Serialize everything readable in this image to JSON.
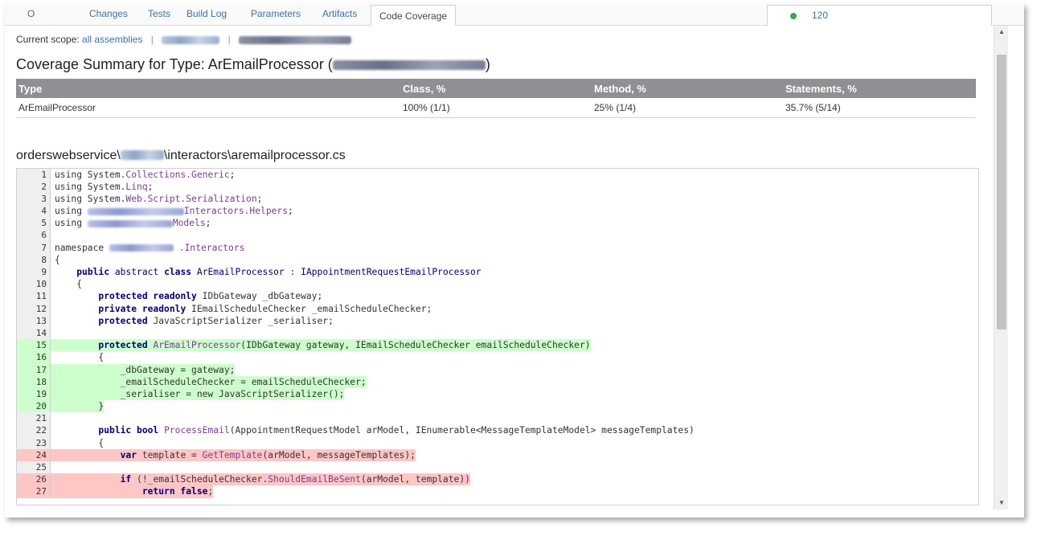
{
  "tabs": [
    {
      "label": "O"
    },
    {
      "label": "Changes"
    },
    {
      "label": "Tests"
    },
    {
      "label": "Build Log"
    },
    {
      "label": "Parameters"
    },
    {
      "label": "Artifacts"
    },
    {
      "label": "Code Coverage"
    }
  ],
  "right_tab": {
    "count": "120"
  },
  "scope": {
    "label": "Current scope:",
    "link_all": "all assemblies",
    "separator": "|"
  },
  "summary": {
    "title_prefix": "Coverage Summary for Type: ArEmailProcessor (",
    "title_suffix": ")"
  },
  "table": {
    "headers": [
      "Type",
      "Class, %",
      "Method, %",
      "Statements, %"
    ],
    "row": [
      "ArEmailProcessor",
      "100% (1/1)",
      "25% (1/4)",
      "35.7% (5/14)"
    ]
  },
  "file": {
    "prefix": "orderswebservice\\",
    "suffix": "\\interactors\\aremailprocessor.cs"
  },
  "code": {
    "lines": [
      {
        "n": "1"
      },
      {
        "n": "2"
      },
      {
        "n": "3"
      },
      {
        "n": "4"
      },
      {
        "n": "5"
      },
      {
        "n": "6"
      },
      {
        "n": "7"
      },
      {
        "n": "8"
      },
      {
        "n": "9"
      },
      {
        "n": "10"
      },
      {
        "n": "11"
      },
      {
        "n": "12"
      },
      {
        "n": "13"
      },
      {
        "n": "14"
      },
      {
        "n": "15"
      },
      {
        "n": "16"
      },
      {
        "n": "17"
      },
      {
        "n": "18"
      },
      {
        "n": "19"
      },
      {
        "n": "20"
      },
      {
        "n": "21"
      },
      {
        "n": "22"
      },
      {
        "n": "23"
      },
      {
        "n": "24"
      },
      {
        "n": "25"
      },
      {
        "n": "26"
      },
      {
        "n": "27"
      }
    ],
    "colors": {
      "covered": "#ccffcc",
      "uncovered": "#ffc6c6"
    }
  }
}
